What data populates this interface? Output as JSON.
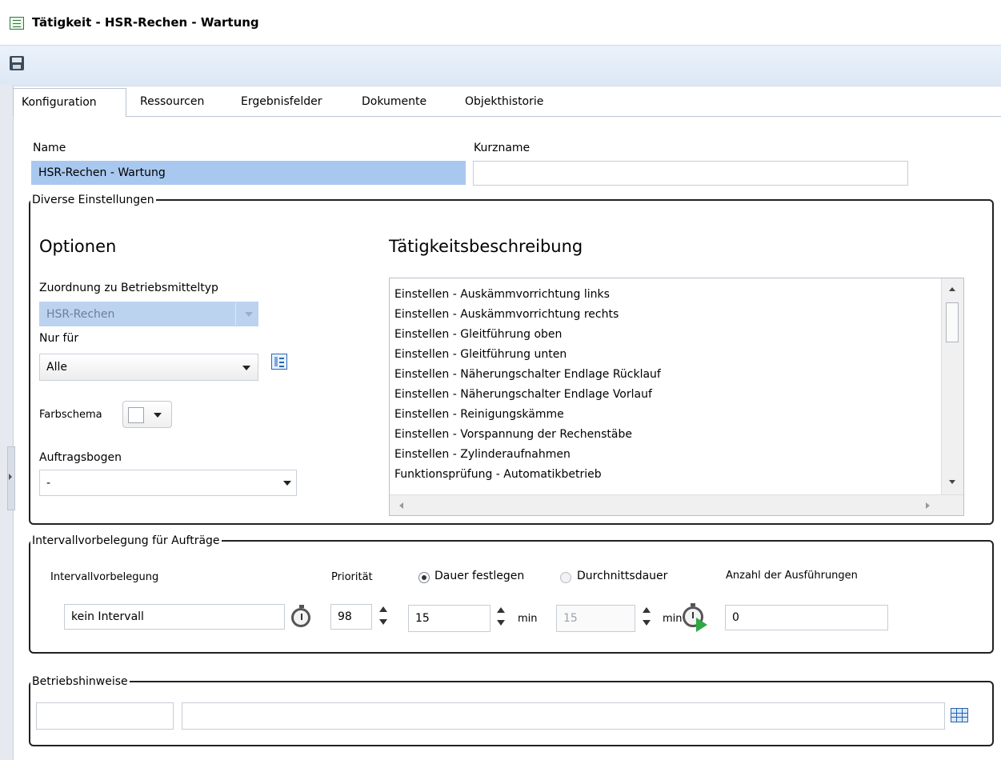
{
  "window": {
    "title": "Tätigkeit - HSR-Rechen - Wartung"
  },
  "tabs": [
    {
      "label": "Konfiguration"
    },
    {
      "label": "Ressourcen"
    },
    {
      "label": "Ergebnisfelder"
    },
    {
      "label": "Dokumente"
    },
    {
      "label": "Objekthistorie"
    }
  ],
  "form": {
    "name_label": "Name",
    "name_value": "HSR-Rechen - Wartung",
    "kurzname_label": "Kurzname",
    "kurzname_value": ""
  },
  "diverse": {
    "legend": "Diverse Einstellungen",
    "optionen_title": "Optionen",
    "zuordnung_label": "Zuordnung zu Betriebsmitteltyp",
    "zuordnung_value": "HSR-Rechen",
    "nurfuer_label": "Nur für",
    "nurfuer_value": "Alle",
    "farbschema_label": "Farbschema",
    "auftragsbogen_label": "Auftragsbogen",
    "auftragsbogen_value": "-",
    "beschreibung_title": "Tätigkeitsbeschreibung",
    "beschreibung_items": [
      "Einstellen - Auskämmvorrichtung links",
      "Einstellen - Auskämmvorrichtung rechts",
      "Einstellen - Gleitführung oben",
      "Einstellen - Gleitführung unten",
      "Einstellen - Näherungschalter Endlage Rücklauf",
      "Einstellen - Näherungschalter Endlage Vorlauf",
      "Einstellen - Reinigungskämme",
      "Einstellen - Vorspannung der Rechenstäbe",
      "Einstellen - Zylinderaufnahmen",
      "Funktionsprüfung - Automatikbetrieb"
    ]
  },
  "intervall": {
    "legend": "Intervallvorbelegung für Aufträge",
    "intervall_label": "Intervallvorbelegung",
    "intervall_value": "kein Intervall",
    "prioritaet_label": "Priorität",
    "prioritaet_value": "98",
    "dauer_festlegen_label": "Dauer festlegen",
    "dauer_value": "15",
    "dauer_unit": "min",
    "durchschnitt_label": "Durchnittsdauer",
    "durchschnitt_value": "15",
    "durchschnitt_unit": "min",
    "anzahl_label": "Anzahl der Ausführungen",
    "anzahl_value": "0"
  },
  "betrieb": {
    "legend": "Betriebshinweise"
  }
}
